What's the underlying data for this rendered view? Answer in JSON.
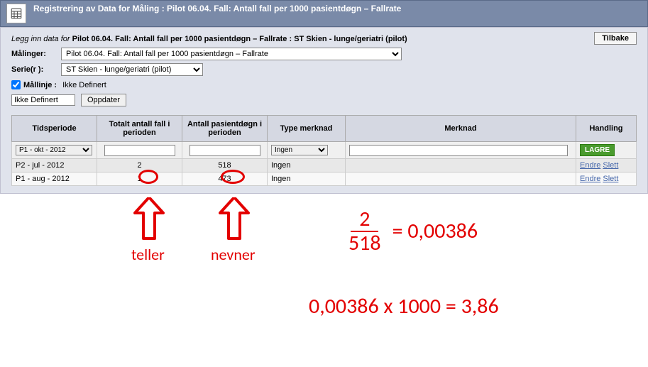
{
  "header": {
    "title": "Registrering av Data for Måling : Pilot 06.04. Fall: Antall fall per 1000 pasientdøgn – Fallrate"
  },
  "instruction_prefix": "Legg inn data for ",
  "instruction_bold": "Pilot 06.04. Fall: Antall fall per 1000 pasientdøgn – Fallrate : ST Skien - lunge/geriatri (pilot)",
  "labels": {
    "malinger": "Målinger:",
    "serier": "Serie(r ):",
    "mallinje": "Mållinje :",
    "mallinje_value": "Ikke Definert",
    "oppdater": "Oppdater",
    "tilbake": "Tilbake",
    "ikke_definert_ph": "Ikke Definert",
    "lagre": "LAGRE",
    "endre": "Endre",
    "slett": "Slett"
  },
  "selects": {
    "maling": "Pilot 06.04. Fall: Antall fall per 1000 pasientdøgn – Fallrate",
    "serie": "ST Skien - lunge/geriatri (pilot)"
  },
  "table": {
    "headers": {
      "tidsperiode": "Tidsperiode",
      "totalt": "Totalt antall fall i perioden",
      "antall": "Antall pasientdøgn i perioden",
      "type": "Type merknad",
      "merknad": "Merknad",
      "handling": "Handling"
    },
    "entry_row": {
      "period": "P1 - okt - 2012",
      "type": "Ingen"
    },
    "rows": [
      {
        "period": "P2 - jul - 2012",
        "totalt": "2",
        "antall": "518",
        "type": "Ingen"
      },
      {
        "period": "P1 - aug - 2012",
        "totalt": "1",
        "antall": "473",
        "type": "Ingen"
      }
    ]
  },
  "annotations": {
    "teller": "teller",
    "nevner": "nevner",
    "frac_num": "2",
    "frac_den": "518",
    "eq1_res": "= 0,00386",
    "eq2": "0,00386 x 1000 = 3,86"
  }
}
